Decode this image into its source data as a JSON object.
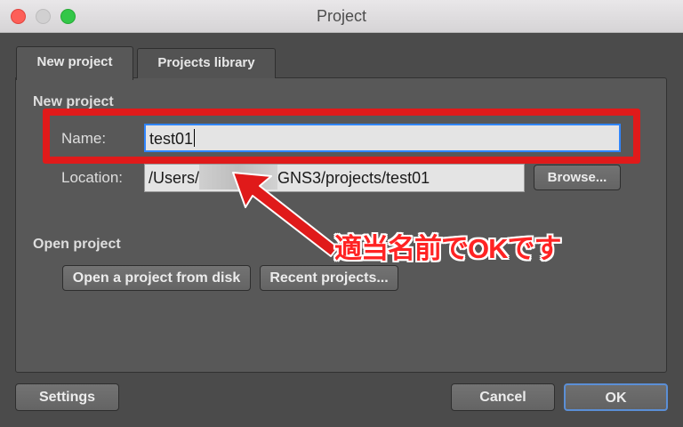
{
  "window": {
    "title": "Project"
  },
  "tabs": [
    {
      "label": "New project",
      "active": true
    },
    {
      "label": "Projects library",
      "active": false
    }
  ],
  "new_project": {
    "section_label": "New project",
    "name_label": "Name:",
    "name_value": "test01",
    "location_label": "Location:",
    "location_prefix": "/Users/",
    "location_suffix": "GNS3/projects/test01",
    "browse_label": "Browse..."
  },
  "open_project": {
    "section_label": "Open project",
    "open_from_disk_label": "Open a project from disk",
    "recent_projects_label": "Recent projects..."
  },
  "footer": {
    "settings_label": "Settings",
    "cancel_label": "Cancel",
    "ok_label": "OK"
  },
  "annotation": {
    "text": "適当名前でOKです",
    "color": "#ff2323"
  },
  "colors": {
    "highlight": "#e01a1a",
    "focus": "#2f85ff"
  }
}
